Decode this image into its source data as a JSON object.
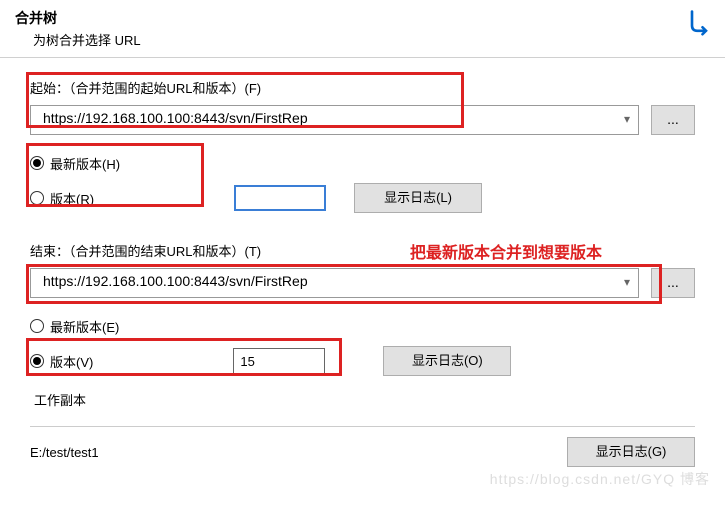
{
  "header": {
    "title": "合并树",
    "subtitle": "为树合并选择 URL"
  },
  "start": {
    "label": "起始：（合并范围的起始URL和版本）(F)",
    "url": "https://192.168.100.100:8443/svn/FirstRep",
    "browse": "...",
    "radio_head": "最新版本(H)",
    "radio_rev": "版本(R)",
    "rev_value": "",
    "show_log": "显示日志(L)"
  },
  "end": {
    "label": "结束：（合并范围的结束URL和版本）(T)",
    "url": "https://192.168.100.100:8443/svn/FirstRep",
    "browse": "...",
    "radio_head": "最新版本(E)",
    "radio_rev": "版本(V)",
    "rev_value": "15",
    "show_log": "显示日志(O)"
  },
  "annotation": "把最新版本合并到想要版本",
  "wc": {
    "label": "工作副本",
    "path": "E:/test/test1",
    "show_log": "显示日志(G)"
  },
  "watermark": "https://blog.csdn.net/GYQ 博客"
}
